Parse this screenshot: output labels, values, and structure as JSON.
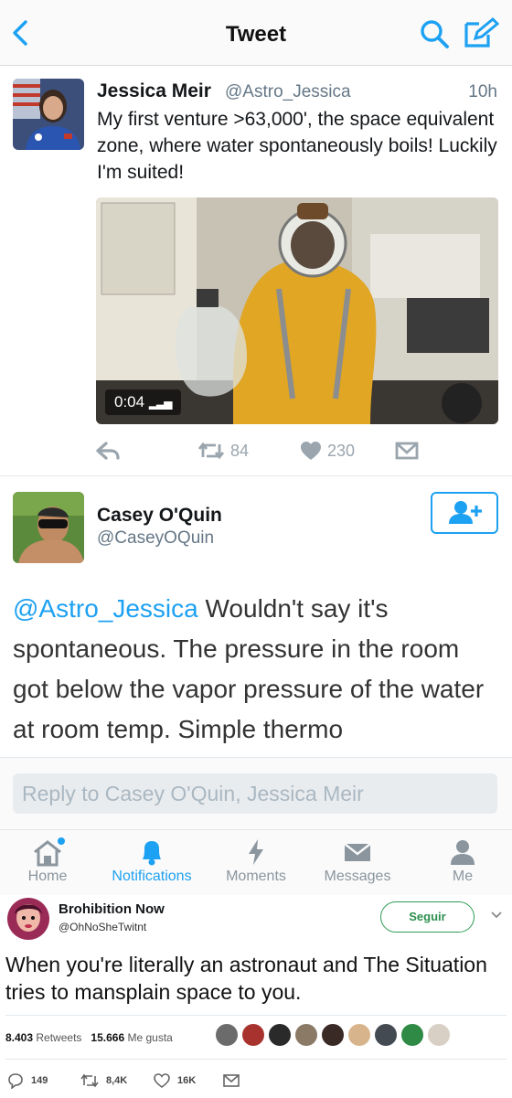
{
  "header": {
    "title": "Tweet",
    "back_icon": "chevron-left-icon",
    "search_icon": "search-icon",
    "compose_icon": "compose-icon"
  },
  "tweet": {
    "name": "Jessica Meir",
    "handle": "@Astro_Jessica",
    "time": "10h",
    "text": "My first venture >63,000', the space equivalent zone, where water spontaneously boils! Luckily I'm suited!",
    "video_duration": "0:04",
    "retweets": "84",
    "likes": "230"
  },
  "reply": {
    "name": "Casey O'Quin",
    "handle": "@CaseyOQuin",
    "mention": "@Astro_Jessica",
    "text": " Wouldn't say it's spontaneous. The pressure in the room got below the vapor pressure of the water at room temp. Simple thermo",
    "placeholder": "Reply to Casey O'Quin, Jessica Meir"
  },
  "tabs": [
    {
      "label": "Home",
      "icon": "home-icon"
    },
    {
      "label": "Notifications",
      "icon": "bell-icon"
    },
    {
      "label": "Moments",
      "icon": "lightning-icon"
    },
    {
      "label": "Messages",
      "icon": "envelope-icon"
    },
    {
      "label": "Me",
      "icon": "person-icon"
    }
  ],
  "quote_tweet": {
    "name": "Brohibition Now",
    "handle": "@OhNoSheTwitnt",
    "follow_label": "Seguir",
    "text": "When you're literally an astronaut and The Situation tries to mansplain space to you.",
    "retweets_count": "8.403",
    "retweets_label": "Retweets",
    "likes_count": "15.666",
    "likes_label": "Me gusta",
    "replies": "149",
    "retweets_short": "8,4K",
    "likes_short": "16K"
  },
  "colors": {
    "accent": "#1da1f2",
    "follow_green": "#2c9c53",
    "muted": "#657786"
  }
}
